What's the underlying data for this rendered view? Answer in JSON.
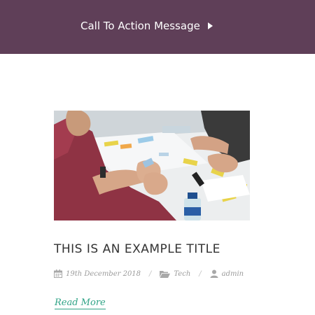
{
  "cta": {
    "label": "Call To Action Message",
    "icon": "caret-right-icon",
    "background": "#5f3f58",
    "text_color": "#ffffff"
  },
  "post": {
    "title": "THIS IS AN EXAMPLE TITLE",
    "date": "19th December 2018",
    "category": "Tech",
    "author": "admin",
    "read_more": "Read More",
    "separator": "/",
    "icons": {
      "date": "calendar-icon",
      "category": "folder-open-icon",
      "author": "user-icon"
    },
    "accent": "#2fa386"
  }
}
